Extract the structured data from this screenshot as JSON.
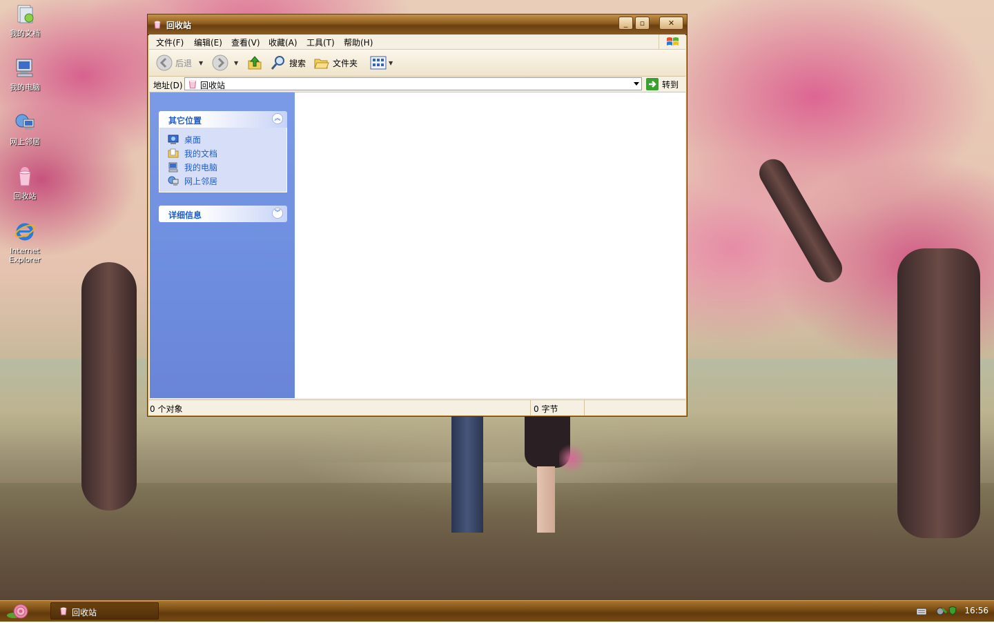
{
  "desktop": {
    "icons": [
      {
        "label": "我的文档",
        "icon": "my-documents-icon"
      },
      {
        "label": "我的电脑",
        "icon": "my-computer-icon"
      },
      {
        "label": "网上邻居",
        "icon": "network-places-icon"
      },
      {
        "label": "回收站",
        "icon": "recycle-bin-icon"
      },
      {
        "label": "Internet Explorer",
        "icon": "internet-explorer-icon"
      }
    ]
  },
  "window": {
    "title": "回收站",
    "menu": [
      "文件(F)",
      "编辑(E)",
      "查看(V)",
      "收藏(A)",
      "工具(T)",
      "帮助(H)"
    ],
    "toolbar": {
      "back_label": "后退",
      "search_label": "搜索",
      "folders_label": "文件夹"
    },
    "address": {
      "label": "地址(D)",
      "value": "回收站",
      "go_label": "转到"
    },
    "sidebar": {
      "other_places_title": "其它位置",
      "other_places": [
        {
          "label": "桌面",
          "icon": "desktop-icon"
        },
        {
          "label": "我的文档",
          "icon": "my-documents-icon"
        },
        {
          "label": "我的电脑",
          "icon": "my-computer-icon"
        },
        {
          "label": "网上邻居",
          "icon": "network-places-icon"
        }
      ],
      "details_title": "详细信息"
    },
    "status": {
      "objects": "0 个对象",
      "size": "0 字节"
    }
  },
  "taskbar": {
    "task_label": "回收站",
    "clock": "16:56"
  },
  "colors": {
    "titlebar": "#8b5a1e",
    "taskbar": "#7c4f16",
    "sidebar": "#7b9ae6",
    "link": "#215dc6"
  }
}
